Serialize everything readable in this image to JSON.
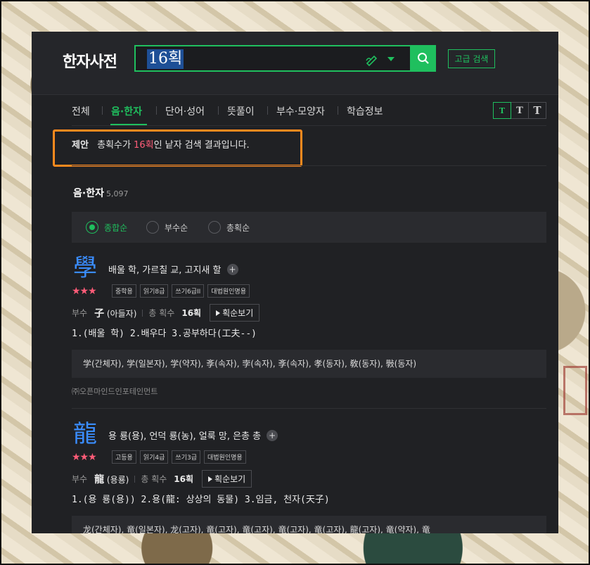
{
  "app": {
    "logo": "한자사전"
  },
  "search": {
    "query": "16획",
    "advanced_label": "고급 검색"
  },
  "tabs": [
    {
      "label": "전체"
    },
    {
      "label": "음·한자"
    },
    {
      "label": "단어·성어"
    },
    {
      "label": "뜻풀이"
    },
    {
      "label": "부수·모양자"
    },
    {
      "label": "학습정보"
    }
  ],
  "font_sizes": [
    "T",
    "T",
    "T"
  ],
  "suggestion": {
    "label": "제안",
    "prefix": "총획수가 ",
    "highlight": "16획",
    "suffix": "인 낱자 검색 결과입니다."
  },
  "section": {
    "title": "음·한자",
    "count": "5,097"
  },
  "sort": [
    {
      "label": "종합순",
      "selected": true
    },
    {
      "label": "부수순",
      "selected": false
    },
    {
      "label": "총획순",
      "selected": false
    }
  ],
  "entries": [
    {
      "hanja": "學",
      "meaning": "배울 학, 가르칠 교, 고지새 할",
      "stars": "★★★",
      "badges": [
        "중학용",
        "읽기8급",
        "쓰기6급II",
        "대법원인명용"
      ],
      "radical_label": "부수",
      "radical_char": "子",
      "radical_name": " (아들자)",
      "strokes_label": "총 획수",
      "strokes": "16획",
      "stroke_btn": "획순보기",
      "definitions": "1.(배울 학) 2.배우다 3.공부하다(工夫--)",
      "variants": "学(간체자), 学(일본자), 学(약자), 斈(속자), 孛(속자), 斈(속자), 孝(동자), 敎(동자), 斅(동자)",
      "source": "㈜오픈마인드인포테인먼트"
    },
    {
      "hanja": "龍",
      "meaning": "용 룡(용), 언덕 룡(농), 얼룩 망, 은총 총",
      "stars": "★★★",
      "badges": [
        "고등용",
        "읽기4급",
        "쓰기3급",
        "대법원인명용"
      ],
      "radical_label": "부수",
      "radical_char": "龍",
      "radical_name": " (용룡)",
      "strokes_label": "총 획수",
      "strokes": "16획",
      "stroke_btn": "획순보기",
      "definitions": "1.(용 룡(용)) 2.용(龍: 상상의 동물) 3.임금, 천자(天子)",
      "variants": "龙(간체자), 竜(일본자), 龙(고자), 竜(고자), 竜(고자), 竜(고자), 竜(고자), 龍(고자), 竜(약자), 竜",
      "source": ""
    }
  ],
  "colors": {
    "accent": "#1fbf5e",
    "hanja": "#3a8dff",
    "star": "#ff5c78",
    "highlight_box": "#ff8a1e"
  }
}
